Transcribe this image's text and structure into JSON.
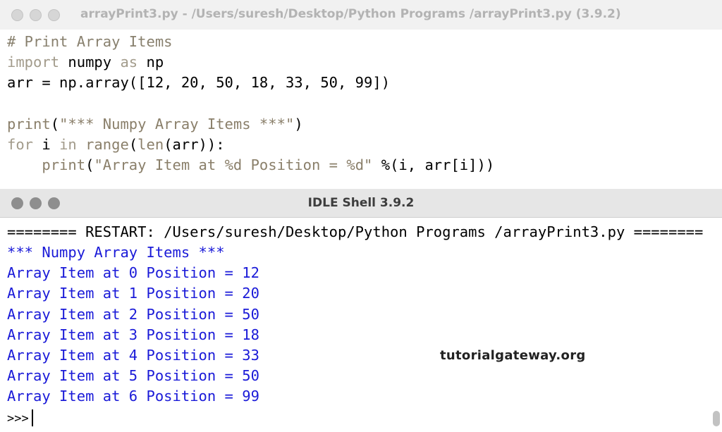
{
  "editor": {
    "title": "arrayPrint3.py - /Users/suresh/Desktop/Python Programs /arrayPrint3.py (3.9.2)",
    "lines": [
      {
        "parts": [
          {
            "t": "# Print Array Items",
            "c": "comment"
          }
        ]
      },
      {
        "parts": [
          {
            "t": "import",
            "c": "keyword"
          },
          {
            "t": " numpy ",
            "c": "plain"
          },
          {
            "t": "as",
            "c": "keyword"
          },
          {
            "t": " np",
            "c": "plain"
          }
        ]
      },
      {
        "parts": [
          {
            "t": "arr = np.array([12, 20, 50, 18, 33, 50, 99])",
            "c": "plain"
          }
        ]
      },
      {
        "parts": []
      },
      {
        "parts": [
          {
            "t": "print",
            "c": "builtin"
          },
          {
            "t": "(",
            "c": "plain"
          },
          {
            "t": "\"*** Numpy Array Items ***\"",
            "c": "string"
          },
          {
            "t": ")",
            "c": "plain"
          }
        ]
      },
      {
        "parts": [
          {
            "t": "for",
            "c": "keyword"
          },
          {
            "t": " i ",
            "c": "plain"
          },
          {
            "t": "in",
            "c": "keyword"
          },
          {
            "t": " ",
            "c": "plain"
          },
          {
            "t": "range",
            "c": "builtin"
          },
          {
            "t": "(",
            "c": "plain"
          },
          {
            "t": "len",
            "c": "builtin"
          },
          {
            "t": "(arr)):",
            "c": "plain"
          }
        ]
      },
      {
        "parts": [
          {
            "t": "    ",
            "c": "plain"
          },
          {
            "t": "print",
            "c": "builtin"
          },
          {
            "t": "(",
            "c": "plain"
          },
          {
            "t": "\"Array Item at %d Position = %d\"",
            "c": "string"
          },
          {
            "t": " %(i, arr[i]))",
            "c": "plain"
          }
        ]
      }
    ]
  },
  "shell": {
    "title": "IDLE Shell 3.9.2",
    "restart_line": "======== RESTART: /Users/suresh/Desktop/Python Programs /arrayPrint3.py ========",
    "output_lines": [
      "*** Numpy Array Items ***",
      "Array Item at 0 Position = 12",
      "Array Item at 1 Position = 20",
      "Array Item at 2 Position = 50",
      "Array Item at 3 Position = 18",
      "Array Item at 4 Position = 33",
      "Array Item at 5 Position = 50",
      "Array Item at 6 Position = 99"
    ],
    "prompt": ">>>"
  },
  "watermark": "tutorialgateway.org"
}
